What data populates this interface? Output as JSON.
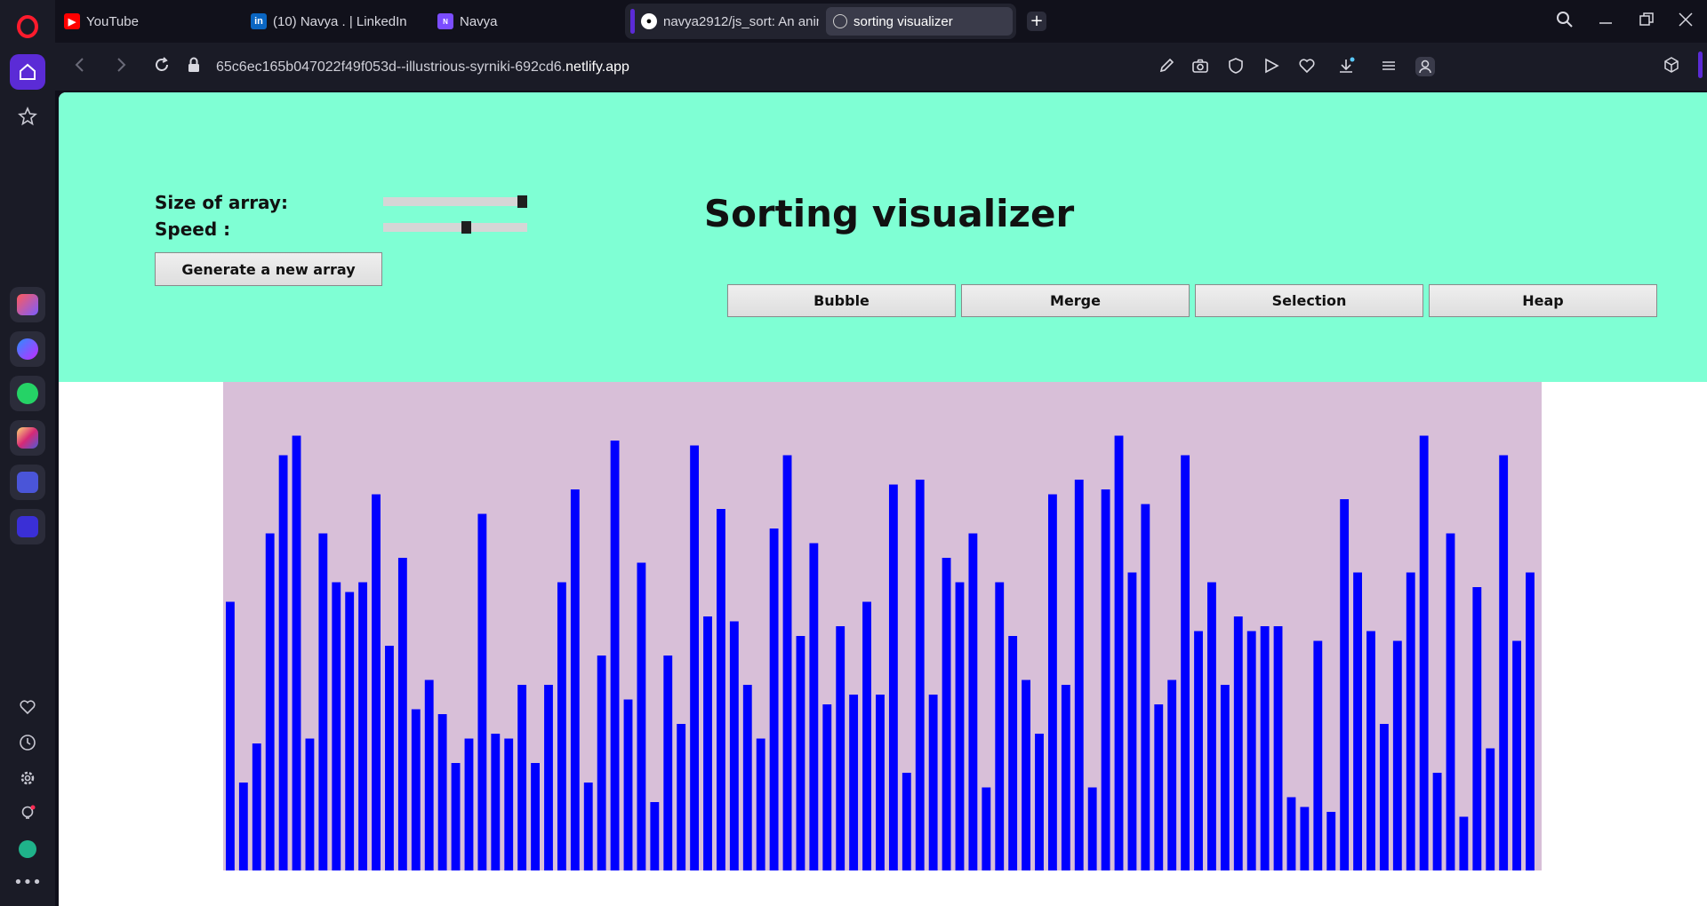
{
  "browser": {
    "tabs": [
      {
        "label": "YouTube",
        "icon": "youtube-icon"
      },
      {
        "label": "(10) Navya . | LinkedIn",
        "icon": "linkedin-icon"
      },
      {
        "label": "Navya",
        "icon": "portfolio-icon"
      },
      {
        "label": "navya2912/js_sort: An anim",
        "icon": "github-icon"
      },
      {
        "label": "sorting visualizer",
        "icon": "globe-icon",
        "active": true
      }
    ],
    "url_prefix": "65c6ec165b047022f49f053d--illustrious-syrniki-692cd6.",
    "url_domain": "netlify.app"
  },
  "page": {
    "title": "Sorting visualizer",
    "size_label": "Size of array:",
    "speed_label": "Speed :",
    "size_value": 1.0,
    "speed_value": 0.58,
    "generate_button": "Generate a new array",
    "algorithms": [
      "Bubble",
      "Merge",
      "Selection",
      "Heap"
    ]
  },
  "colors": {
    "header_bg": "#7fffd4",
    "chart_bg": "#d8bfd8",
    "bar": "#0000ff"
  },
  "chart_data": {
    "type": "bar",
    "values": [
      55,
      18,
      26,
      69,
      85,
      89,
      27,
      69,
      59,
      57,
      59,
      77,
      46,
      64,
      33,
      39,
      32,
      22,
      27,
      73,
      28,
      27,
      38,
      22,
      38,
      59,
      78,
      18,
      44,
      88,
      35,
      63,
      14,
      44,
      30,
      87,
      52,
      74,
      51,
      38,
      27,
      70,
      85,
      48,
      67,
      34,
      50,
      36,
      55,
      36,
      79,
      20,
      80,
      36,
      64,
      59,
      69,
      17,
      59,
      48,
      39,
      28,
      77,
      38,
      80,
      17,
      78,
      89,
      61,
      75,
      34,
      39,
      85,
      49,
      59,
      38,
      52,
      49,
      50,
      50,
      15,
      13,
      47,
      12,
      76,
      61,
      49,
      30,
      47,
      61,
      89,
      20,
      69,
      11,
      58,
      25,
      85,
      47,
      61
    ],
    "ylim": [
      0,
      100
    ]
  }
}
